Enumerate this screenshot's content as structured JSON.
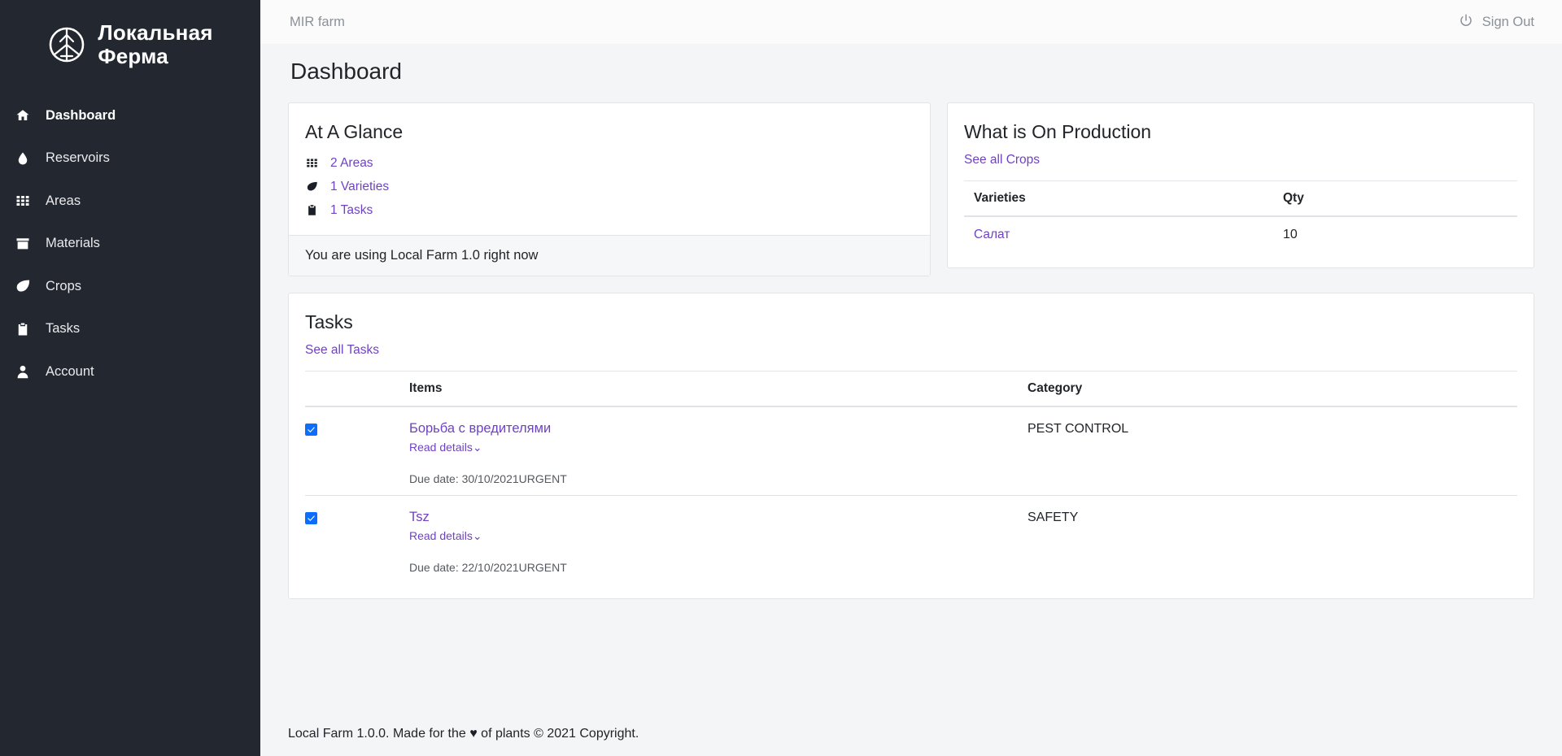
{
  "brand": {
    "name": "Локальная\nФерма",
    "logo_icon": "wheel-logo-icon"
  },
  "sidebar": {
    "items": [
      {
        "label": "Dashboard",
        "icon": "home-icon",
        "active": true
      },
      {
        "label": "Reservoirs",
        "icon": "water-drop-icon",
        "active": false
      },
      {
        "label": "Areas",
        "icon": "grid-icon",
        "active": false
      },
      {
        "label": "Materials",
        "icon": "archive-icon",
        "active": false
      },
      {
        "label": "Crops",
        "icon": "leaf-icon",
        "active": false
      },
      {
        "label": "Tasks",
        "icon": "clipboard-icon",
        "active": false
      },
      {
        "label": "Account",
        "icon": "user-icon",
        "active": false
      }
    ]
  },
  "topbar": {
    "farm_name": "MIR farm",
    "sign_out_label": "Sign Out",
    "sign_out_icon": "power-icon"
  },
  "page": {
    "title": "Dashboard"
  },
  "glance": {
    "title": "At A Glance",
    "items": [
      {
        "label": "2 Areas",
        "icon": "grid-icon"
      },
      {
        "label": "1 Varieties",
        "icon": "leaf-icon"
      },
      {
        "label": "1 Tasks",
        "icon": "clipboard-icon"
      }
    ],
    "footer_note": "You are using Local Farm 1.0 right now"
  },
  "production": {
    "title": "What is On Production",
    "see_all_label": "See all Crops",
    "columns": {
      "varieties": "Varieties",
      "qty": "Qty"
    },
    "rows": [
      {
        "variety": "Салат",
        "qty": "10"
      }
    ]
  },
  "tasks": {
    "title": "Tasks",
    "see_all_label": "See all Tasks",
    "columns": {
      "items": "Items",
      "category": "Category"
    },
    "rows": [
      {
        "name": "Борьба с вредителями",
        "read_details": "Read details",
        "due": "Due date: 30/10/2021URGENT",
        "category": "PEST CONTROL",
        "checked": true
      },
      {
        "name": "Tsz",
        "read_details": "Read details",
        "due": "Due date: 22/10/2021URGENT",
        "category": "SAFETY",
        "checked": true
      }
    ]
  },
  "footer": {
    "text_before": "Local Farm 1.0.0. Made for the ",
    "heart": "♥",
    "text_after": " of plants © 2021 Copyright."
  },
  "colors": {
    "sidebar_bg": "#232730",
    "page_bg": "#f4f5f6",
    "link_purple": "#6f42c1",
    "checkbox_blue": "#0d6efd",
    "muted_text": "#8a9199"
  }
}
